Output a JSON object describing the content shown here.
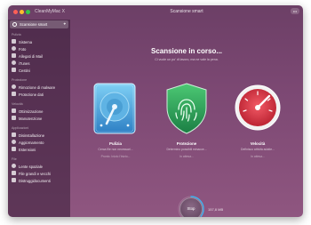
{
  "app": {
    "name": "CleanMyMac X",
    "window_title": "Scansione smart",
    "help_label": "•••"
  },
  "sidebar": {
    "scan_item": {
      "label": "Scansione smart",
      "icon": "smart-scan-icon"
    },
    "sections": [
      {
        "title": "Pulizia",
        "items": [
          {
            "label": "Sistema",
            "icon": "system-icon"
          },
          {
            "label": "Foto",
            "icon": "photos-icon"
          },
          {
            "label": "Allegati di Mail",
            "icon": "mail-icon"
          },
          {
            "label": "iTunes",
            "icon": "music-icon"
          },
          {
            "label": "Cestini",
            "icon": "trash-icon"
          }
        ]
      },
      {
        "title": "Protezione",
        "items": [
          {
            "label": "Rimozione di malware",
            "icon": "biohazard-icon"
          },
          {
            "label": "Protezione dati",
            "icon": "hand-icon"
          }
        ]
      },
      {
        "title": "Velocità",
        "items": [
          {
            "label": "Ottimizzazione",
            "icon": "sliders-icon"
          },
          {
            "label": "Manutenzione",
            "icon": "wrench-icon"
          }
        ]
      },
      {
        "title": "Applicazioni",
        "items": [
          {
            "label": "Disinstallazione",
            "icon": "uninstaller-icon"
          },
          {
            "label": "Aggiornamento",
            "icon": "updater-icon"
          },
          {
            "label": "Estensioni",
            "icon": "extensions-icon"
          }
        ]
      },
      {
        "title": "File",
        "items": [
          {
            "label": "Lente spaziale",
            "icon": "lens-icon"
          },
          {
            "label": "File grandi e vecchi",
            "icon": "folder-icon"
          },
          {
            "label": "Distruggidocumenti",
            "icon": "shredder-icon"
          }
        ]
      }
    ]
  },
  "main": {
    "heading": "Scansione in corso...",
    "subheading": "Ci vuole un po' di lavoro, ma ne vale la pena.",
    "cards": [
      {
        "title": "Pulizia",
        "desc": "Cerca file non necessari...",
        "status": "Pronto. Inizio l'Inizio...",
        "icon": "hard-drive-icon",
        "color": "#3f9ad6"
      },
      {
        "title": "Protezione",
        "desc": "Determino possibili minacce...",
        "status": "In attesa...",
        "icon": "fingerprint-shield-icon",
        "color": "#2fa35a"
      },
      {
        "title": "Velocità",
        "desc": "Definisco attività adatte...",
        "status": "In attesa...",
        "icon": "speedometer-icon",
        "color": "#e13a49"
      }
    ],
    "stop_label": "Stop",
    "scanned_size": "157,8 MB",
    "scan_progress": 0.35
  }
}
